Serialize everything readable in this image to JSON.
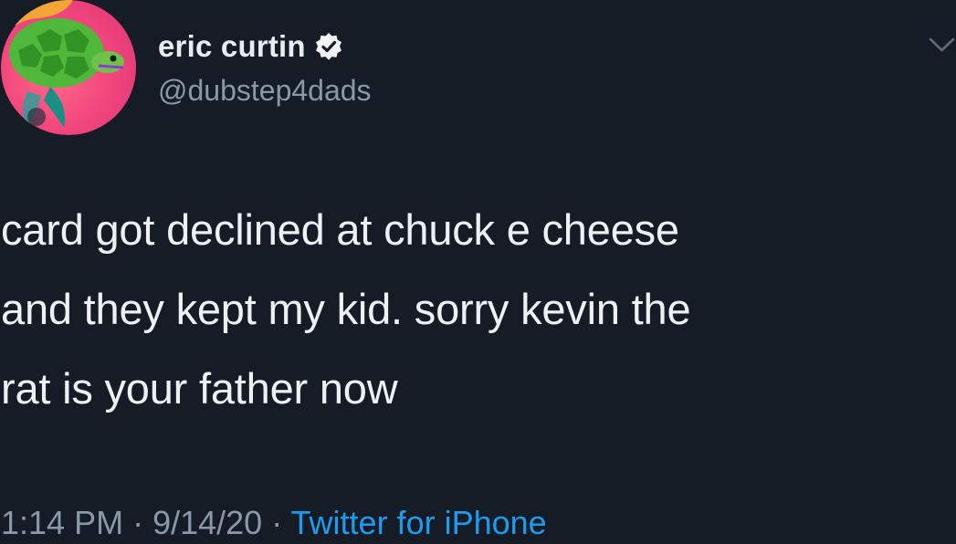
{
  "author": {
    "display_name": "eric curtin",
    "handle": "@dubstep4dads",
    "verified": true,
    "avatar_icon": "turtle-avatar",
    "verified_icon": "verified-badge-icon"
  },
  "tweet": {
    "lines": [
      "card got declined at chuck e cheese",
      "and they kept my kid. sorry kevin the",
      "rat is your father now"
    ]
  },
  "meta": {
    "time": "1:14 PM",
    "separator": " · ",
    "date": "9/14/20",
    "source": "Twitter for iPhone"
  },
  "menu": {
    "icon": "chevron-down-icon"
  },
  "colors": {
    "background": "#151c26",
    "text": "#eef1f4",
    "secondary": "#8b98a5",
    "link": "#1d9bf0"
  }
}
